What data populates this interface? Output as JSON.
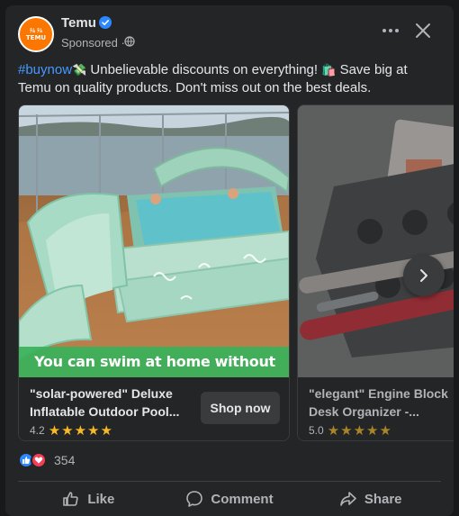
{
  "post": {
    "page_name": "Temu",
    "avatar_line1": "ﾃﾑ ﾃﾑ",
    "avatar_line2": "TEMU",
    "sponsored_label": "Sponsored ·",
    "hashtag": "#buynow",
    "caption_part1": " Unbelievable discounts on everything! ",
    "caption_part2": " Save big at Temu on quality products. Don't miss out on the best deals.",
    "emoji1": "💸",
    "emoji2": "🛍️"
  },
  "carousel": {
    "items": [
      {
        "overlay": "You can swim at home without going out",
        "title": "\"solar-powered\" Deluxe Inflatable Outdoor Pool...",
        "rating": "4.2",
        "stars": "★★★★★",
        "cta": "Shop now"
      },
      {
        "title": "\"elegant\" Engine Block Desk Organizer -...",
        "rating": "5.0",
        "stars": "★★★★★"
      }
    ]
  },
  "engagement": {
    "reaction_count": "354"
  },
  "actions": {
    "like": "Like",
    "comment": "Comment",
    "share": "Share"
  },
  "colors": {
    "brand": "#fb7701",
    "link": "#4599ff",
    "overlay": "#38b25a",
    "star": "#f7b928"
  }
}
